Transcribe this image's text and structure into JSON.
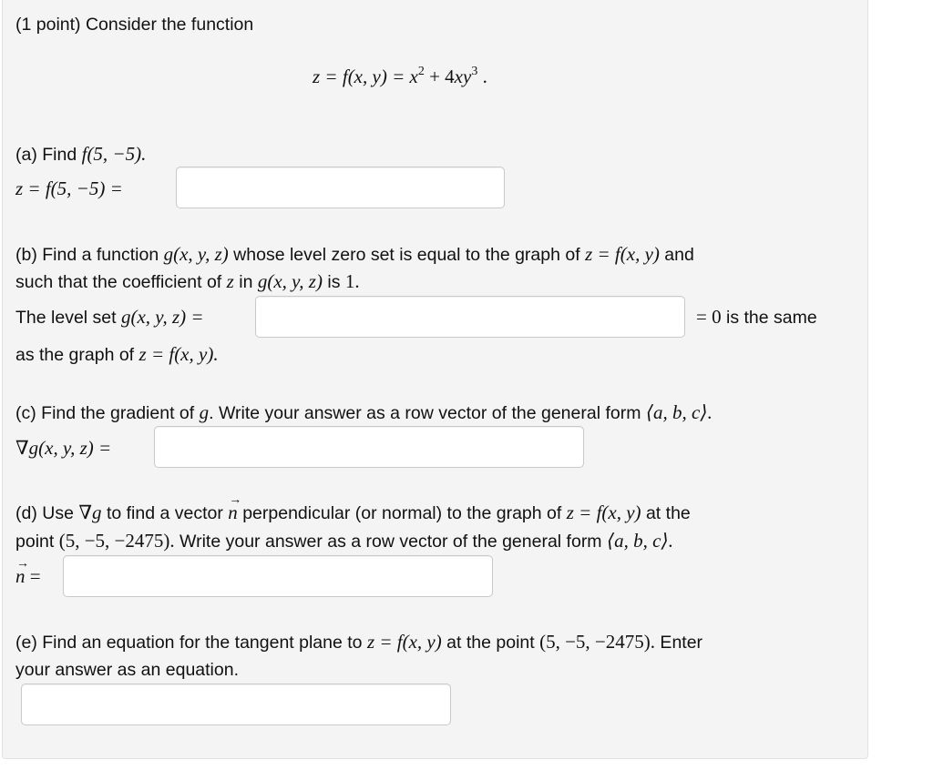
{
  "intro": {
    "text": "(1 point) Consider the function"
  },
  "main_equation": {
    "prefix": "z = ",
    "func": "f",
    "args": "(x, y) = ",
    "x": "x",
    "x_exp": "2",
    "middle": " + 4",
    "xy": "xy",
    "y_exp": "3",
    "suffix": " ."
  },
  "part_a": {
    "prompt_text": "(a) Find ",
    "prompt_math": "f(5, −5).",
    "label_math": "z = f(5, −5) =",
    "input_value": ""
  },
  "part_b": {
    "line1_text_1": "(b) Find a function ",
    "line1_math_1": "g(x, y, z)",
    "line1_text_2": " whose level zero set is equal to the graph of ",
    "line1_math_2": "z = f(x, y)",
    "line1_text_3": " and",
    "line2_text_1": "such that the coefficient of ",
    "line2_math_1": "z",
    "line2_text_2": " in ",
    "line2_math_2": "g(x, y, z)",
    "line2_text_3": " is ",
    "line2_math_3": "1.",
    "label_text": "The level set ",
    "label_math": "g(x, y, z) =",
    "after_math": "= 0",
    "after_text": " is the same",
    "line4_text": "as the graph of ",
    "line4_math": "z = f(x, y).",
    "input_value": ""
  },
  "part_c": {
    "prompt_text_1": "(c) Find the gradient of ",
    "prompt_math_1": "g",
    "prompt_text_2": ". Write your answer as a row vector of the general form ",
    "prompt_math_2": "⟨a, b, c⟩.",
    "label_math": "∇g(x, y, z) =",
    "input_value": ""
  },
  "part_d": {
    "line1_text_1": "(d) Use ",
    "line1_math_1": "∇g",
    "line1_text_2": " to find a vector ",
    "line1_vec": "n",
    "line1_text_3": " perpendicular (or normal) to the graph of ",
    "line1_math_2": "z = f(x, y)",
    "line1_text_4": " at the",
    "line2_text_1": "point ",
    "line2_math_1": "(5, −5, −2475).",
    "line2_text_2": " Write your answer as a row vector of the general form ",
    "line2_math_2": "⟨a, b, c⟩.",
    "label_vec": "n",
    "label_eq": " =",
    "input_value": ""
  },
  "part_e": {
    "line1_text_1": "(e) Find an equation for the tangent plane to ",
    "line1_math_1": "z = f(x, y)",
    "line1_text_2": " at the point ",
    "line1_math_2": "(5, −5, −2475).",
    "line1_text_3": " Enter",
    "line2_text": "your answer as an equation.",
    "input_value": ""
  }
}
